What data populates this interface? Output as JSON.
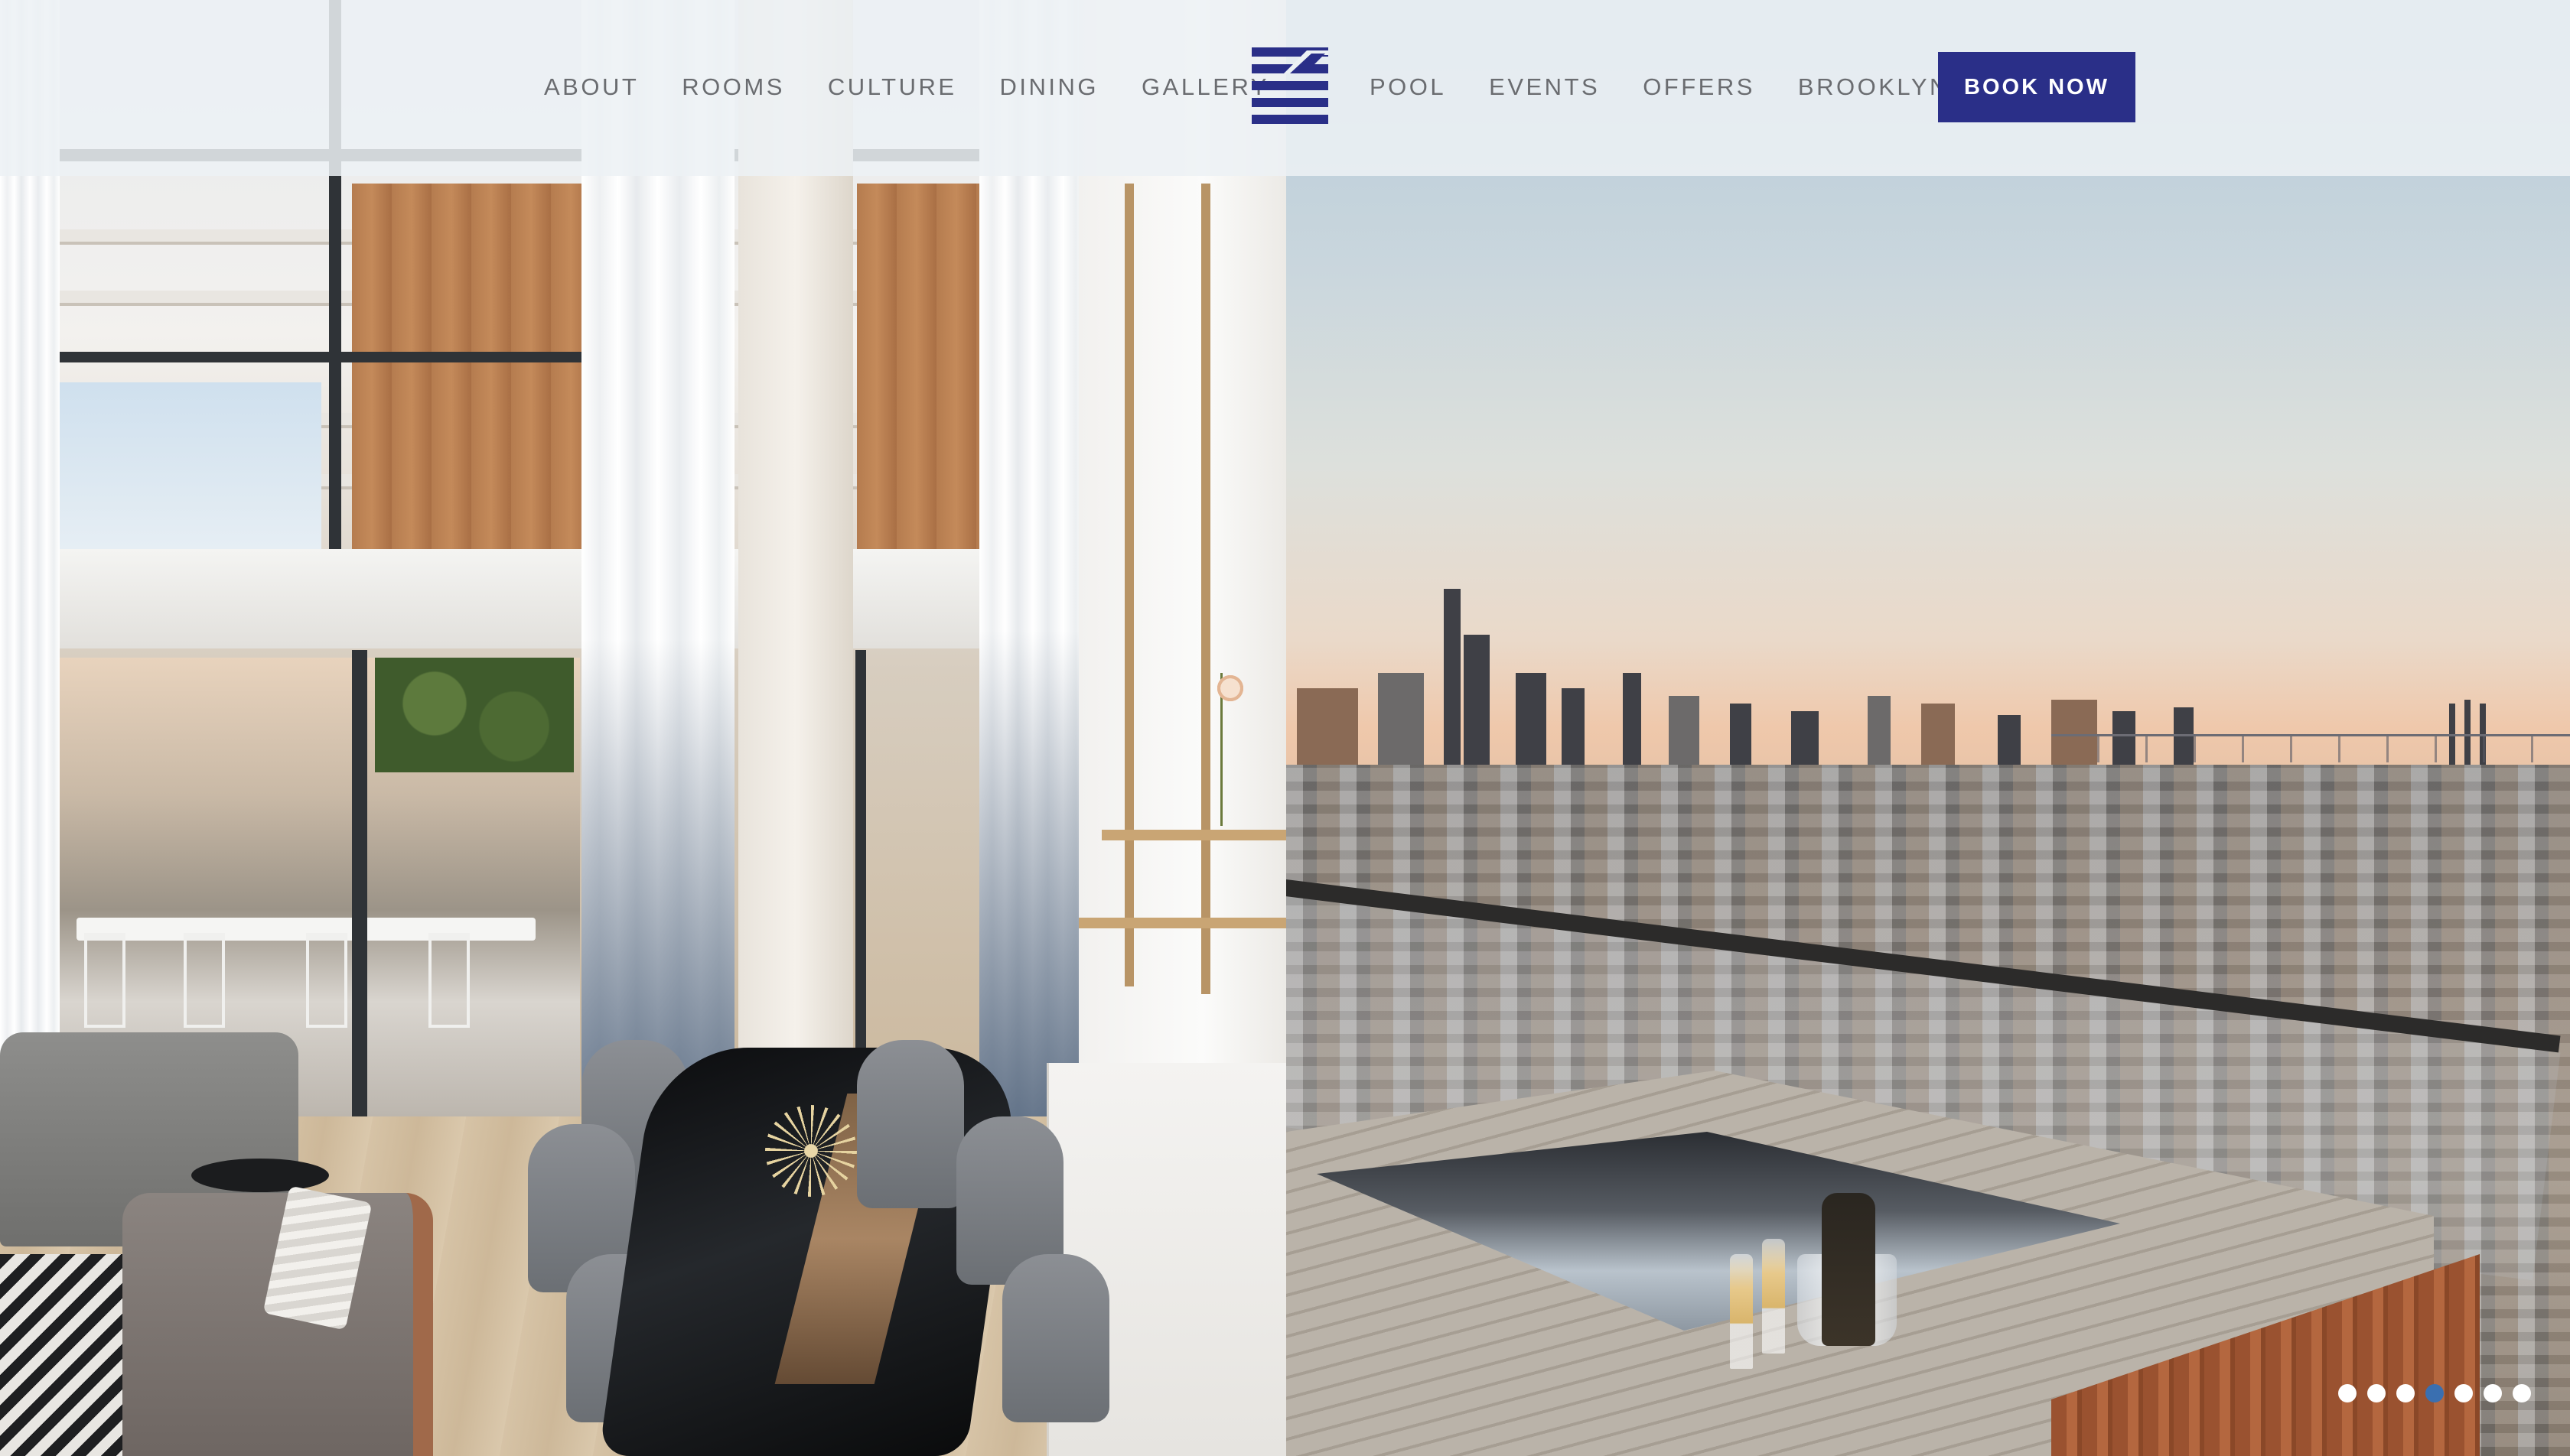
{
  "nav": {
    "left_items": [
      {
        "label": "ABOUT"
      },
      {
        "label": "ROOMS"
      },
      {
        "label": "CULTURE"
      },
      {
        "label": "DINING"
      },
      {
        "label": "GALLERY"
      }
    ],
    "right_items": [
      {
        "label": "POOL"
      },
      {
        "label": "EVENTS"
      },
      {
        "label": "OFFERS"
      },
      {
        "label": "BROOKLYN"
      }
    ],
    "cta_label": "BOOK NOW"
  },
  "logo": {
    "icon": "wythe-stripes-logo-icon"
  },
  "carousel": {
    "slide_count": 7,
    "active_index": 3
  },
  "colors": {
    "brand_navy": "#2a2f88",
    "nav_text": "#6a6c70",
    "header_bg": "#ecf1f4",
    "active_dot": "#3a6fb0"
  }
}
